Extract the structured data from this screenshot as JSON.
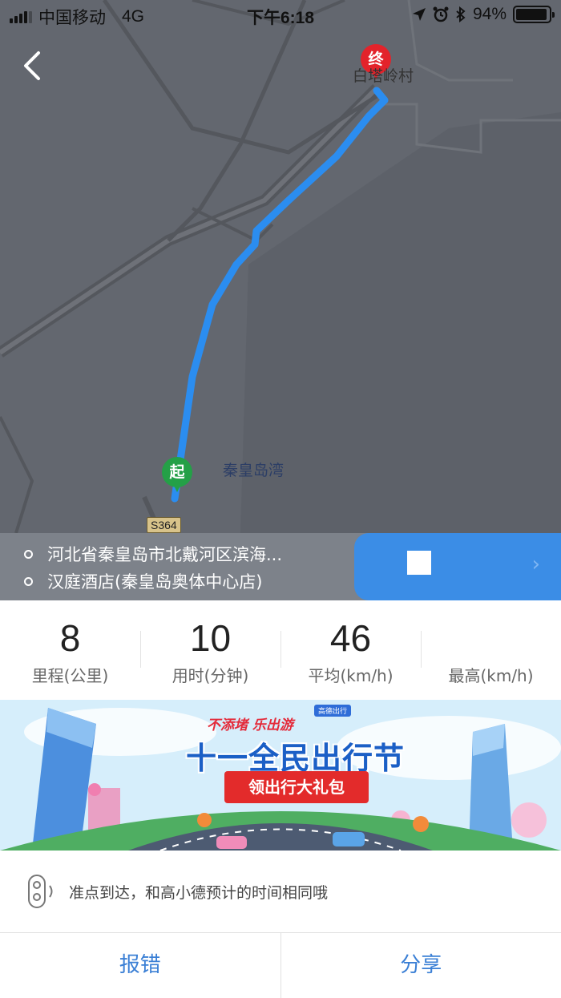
{
  "status_bar": {
    "carrier": "中国移动",
    "network": "4G",
    "time": "下午6:18",
    "battery_text": "94%",
    "battery_level": 0.94
  },
  "map": {
    "place_label": "白塔岭村",
    "bay_label": "秦皇岛湾",
    "road_label": "S364",
    "end_pin": "终",
    "start_pin": "起",
    "route_color": "#2b8df0"
  },
  "route": {
    "from": "河北省秦皇岛市北戴河区滨海...",
    "to": "汉庭酒店(秦皇岛奥体中心店)"
  },
  "stats": [
    {
      "value": "8",
      "label": "里程(公里)"
    },
    {
      "value": "10",
      "label": "用时(分钟)"
    },
    {
      "value": "46",
      "label": "平均(km/h)"
    },
    {
      "value": "",
      "label": "最高(km/h)"
    }
  ],
  "banner": {
    "tagline": "不添堵 乐出游",
    "title": "十一全民出行节",
    "ribbon": "领出行大礼包"
  },
  "note": {
    "text": "准点到达，和高小德预计的时间相同哦"
  },
  "actions": {
    "report": "报错",
    "share": "分享"
  },
  "icons": {
    "back": "chevron-left-icon",
    "location": "location-arrow-icon",
    "alarm": "alarm-icon",
    "bluetooth": "bluetooth-icon"
  }
}
